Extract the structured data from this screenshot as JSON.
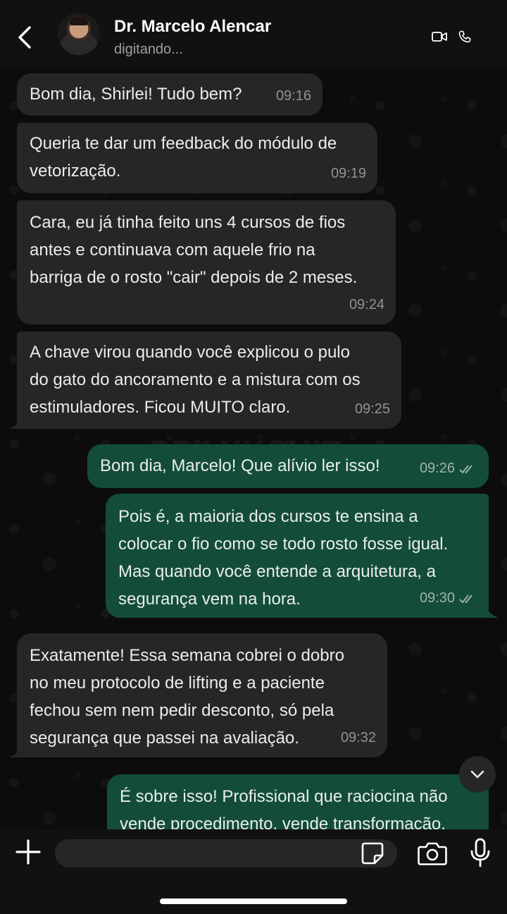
{
  "header": {
    "contact_name": "Dr. Marcelo Alencar",
    "status": "digitando..."
  },
  "watermark": "PRANKSHIT",
  "messages": [
    {
      "direction": "incoming",
      "text": "Bom dia, Shirlei! Tudo bem?",
      "time": "09:16"
    },
    {
      "direction": "incoming",
      "text": "Queria te dar um feedback do módulo de\nvetorização.",
      "time": "09:19"
    },
    {
      "direction": "incoming",
      "text": "Cara, eu já tinha feito uns 4 cursos de fios\nantes e continuava com aquele frio na\nbarriga de o rosto \"cair\" depois de 2 meses.",
      "time": "09:24"
    },
    {
      "direction": "incoming",
      "text": "A chave virou quando você explicou o pulo\ndo gato do ancoramento e a mistura com os\nestimuladores. Ficou MUITO claro.",
      "time": "09:25"
    },
    {
      "direction": "outgoing",
      "text": "Bom dia, Marcelo! Que alívio ler isso!",
      "time": "09:26",
      "status": "read"
    },
    {
      "direction": "outgoing",
      "text": "Pois é, a maioria dos cursos te ensina a\ncolocar o fio como se todo rosto fosse igual.\nMas quando você entende a arquitetura, a\nsegurança vem na hora.",
      "time": "09:30",
      "status": "read"
    },
    {
      "direction": "incoming",
      "text": "Exatamente! Essa semana cobrei o dobro\nno meu protocolo de lifting e a paciente\nfechou sem nem pedir desconto, só pela\nsegurança que passei na avaliação.",
      "time": "09:32"
    },
    {
      "direction": "outgoing",
      "text": "É sobre isso! Profissional que raciocina não\nvende procedimento, vende transformação.",
      "time": ""
    }
  ],
  "composer": {
    "placeholder": ""
  },
  "colors": {
    "incoming_bubble": "#262626",
    "outgoing_bubble": "#144d37",
    "header_bg": "#111111",
    "chat_bg": "#0c0c0c"
  },
  "icons": {
    "back": "chevron-left-icon",
    "video": "video-camera-icon",
    "call": "phone-icon",
    "scroll": "chevron-down-icon",
    "plus": "plus-icon",
    "sticker": "sticker-icon",
    "camera": "camera-icon",
    "mic": "microphone-icon"
  }
}
